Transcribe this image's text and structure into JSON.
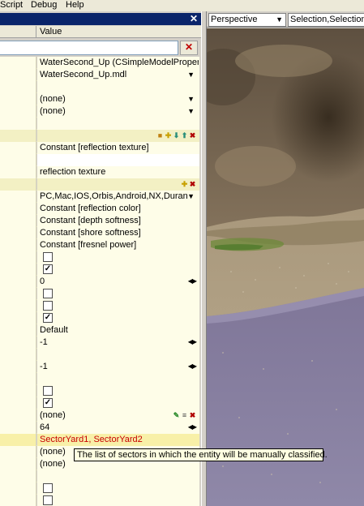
{
  "menubar": {
    "items": [
      "Script",
      "Debug",
      "Help"
    ]
  },
  "panel": {
    "column_header": "Value",
    "filter_value": "",
    "filter_clear_icon": "close-icon"
  },
  "rows": [
    {
      "kind": "value",
      "text": "WaterSecond_Up (CSimpleModelProperties",
      "control": "none"
    },
    {
      "kind": "value",
      "text": "WaterSecond_Up.mdl",
      "control": "dropdown"
    },
    {
      "kind": "empty"
    },
    {
      "kind": "value",
      "text": "(none)",
      "control": "dropdown"
    },
    {
      "kind": "value",
      "text": "(none)",
      "control": "dropdown"
    },
    {
      "kind": "empty"
    },
    {
      "kind": "icons",
      "icons": [
        "copy-icon",
        "add-icon",
        "move-down-icon",
        "move-up-icon",
        "delete-icon"
      ]
    },
    {
      "kind": "value",
      "text": "Constant [reflection texture]",
      "control": "none"
    },
    {
      "kind": "value",
      "text": "",
      "control": "none",
      "white": true
    },
    {
      "kind": "value",
      "text": "reflection texture",
      "control": "none"
    },
    {
      "kind": "icons",
      "icons": [
        "add-icon",
        "delete-icon"
      ]
    },
    {
      "kind": "value",
      "text": "PC,Mac,IOS,Orbis,Android,NX,Durango,...",
      "control": "dropdown"
    },
    {
      "kind": "value",
      "text": "Constant [reflection color]",
      "control": "none"
    },
    {
      "kind": "value",
      "text": "Constant [depth softness]",
      "control": "none"
    },
    {
      "kind": "value",
      "text": "Constant [shore softness]",
      "control": "none"
    },
    {
      "kind": "value",
      "text": "Constant [fresnel power]",
      "control": "none"
    },
    {
      "kind": "checkbox",
      "checked": false
    },
    {
      "kind": "checkbox",
      "checked": true
    },
    {
      "kind": "value",
      "text": "0",
      "control": "spinner"
    },
    {
      "kind": "checkbox",
      "checked": false
    },
    {
      "kind": "checkbox",
      "checked": false
    },
    {
      "kind": "checkbox",
      "checked": true
    },
    {
      "kind": "value",
      "text": "Default",
      "control": "none"
    },
    {
      "kind": "value",
      "text": "-1",
      "control": "spinner"
    },
    {
      "kind": "empty"
    },
    {
      "kind": "value",
      "text": "-1",
      "control": "spinner"
    },
    {
      "kind": "empty"
    },
    {
      "kind": "checkbox",
      "checked": false
    },
    {
      "kind": "checkbox",
      "checked": true
    },
    {
      "kind": "value",
      "text": "(none)",
      "control": "icons",
      "icons": [
        "edit-icon",
        "list-icon",
        "delete-icon"
      ]
    },
    {
      "kind": "value",
      "text": "64",
      "control": "spinner"
    },
    {
      "kind": "value",
      "text": "SectorYard1, SectorYard2",
      "control": "none",
      "selected": true,
      "red": true
    },
    {
      "kind": "value",
      "text": "(none)",
      "control": "icons",
      "icons": [
        "edit-icon",
        "list-icon",
        "delete-icon"
      ]
    },
    {
      "kind": "value",
      "text": "(none)",
      "control": "none"
    },
    {
      "kind": "empty"
    },
    {
      "kind": "checkbox",
      "checked": false
    },
    {
      "kind": "checkbox",
      "checked": false
    }
  ],
  "viewport": {
    "view_mode": "Perspective",
    "selection_label": "Selection,Selection"
  },
  "tooltip": {
    "text": "The list of sectors in which the entity will be manually classified."
  },
  "colors": {
    "title_bar": "#0a246a",
    "row_bg": "#fefde8",
    "selected_row": "#f8f0a8",
    "tooltip_bg": "#ffffe1",
    "red_text": "#c80000"
  }
}
